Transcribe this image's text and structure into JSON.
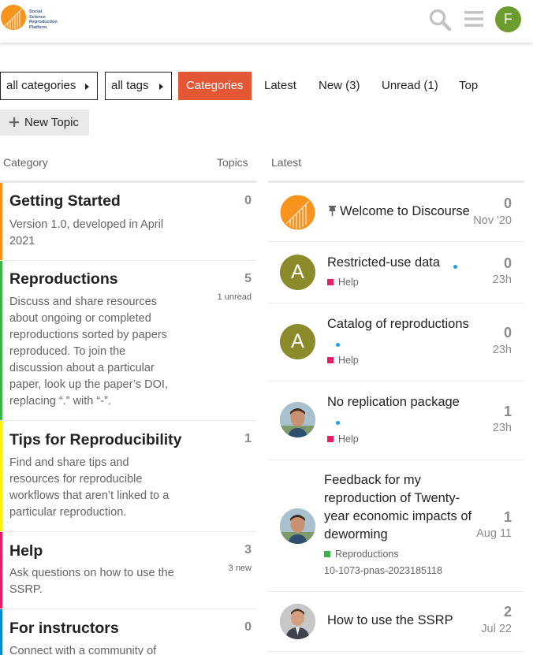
{
  "header": {
    "logo_lines": [
      "Social",
      "Science",
      "Reproduction",
      "Platform"
    ],
    "search_icon": "search-icon",
    "menu_icon": "hamburger-menu-icon",
    "avatar_letter": "F",
    "avatar_color": "#6b9c2d"
  },
  "nav": {
    "categories_dropdown": "all categories",
    "tags_dropdown": "all tags",
    "tabs": [
      "Categories",
      "Latest",
      "New (3)",
      "Unread (1)",
      "Top"
    ],
    "active_tab": "Categories",
    "accent": "#e45735"
  },
  "new_topic_label": "New Topic",
  "columns": {
    "category": "Category",
    "topics": "Topics",
    "latest": "Latest"
  },
  "categories": [
    {
      "name": "Getting Started",
      "description": "Version 1.0, developed in April 2021",
      "count": "0",
      "sub": "",
      "color": "#f7941d"
    },
    {
      "name": "Reproductions",
      "description": "Discuss and share resources about ongoing or completed reproductions sorted by papers reproduced. To join the discussion about a particular paper, look up the paper’s DOI, replacing “.” with “-”.",
      "count": "5",
      "sub": "1 unread",
      "color": "#3ab54a"
    },
    {
      "name": "Tips for Reproducibility",
      "description": "Find and share tips and resources for reproducible workflows that aren’t linked to a particular reproduction.",
      "count": "1",
      "sub": "",
      "color": "#fff200"
    },
    {
      "name": "Help",
      "description": "Ask questions on how to use the SSRP.",
      "count": "3",
      "sub": "3 new",
      "color": "#e71d6a"
    },
    {
      "name": "For instructors",
      "description": "Connect with a community of",
      "count": "0",
      "sub": "",
      "color": "#0088cc"
    }
  ],
  "latest_topics": [
    {
      "title": "Welcome to Discourse",
      "category": "",
      "category_color": "",
      "replies": "0",
      "age": "Nov '20",
      "pinned": true,
      "avatar": "logo",
      "avatar_letter": "",
      "tags": ""
    },
    {
      "title": "Restricted-use data",
      "category": "Help",
      "category_color": "#e71d6a",
      "replies": "0",
      "age": "23h",
      "pinned": false,
      "avatar": "letter",
      "avatar_letter": "A",
      "tags": ""
    },
    {
      "title": "Catalog of reproductions",
      "category": "Help",
      "category_color": "#e71d6a",
      "replies": "0",
      "age": "23h",
      "pinned": false,
      "avatar": "letter",
      "avatar_letter": "A",
      "tags": ""
    },
    {
      "title": "No replication package",
      "category": "Help",
      "category_color": "#e71d6a",
      "replies": "1",
      "age": "23h",
      "pinned": false,
      "avatar": "photo",
      "avatar_letter": "",
      "tags": ""
    },
    {
      "title": "Feedback for my reproduction of Twenty-year economic impacts of deworming",
      "category": "Reproductions",
      "category_color": "#3ab54a",
      "replies": "1",
      "age": "Aug 11",
      "pinned": false,
      "avatar": "photo",
      "avatar_letter": "",
      "tags": "10-1073-pnas-2023185118"
    },
    {
      "title": "How to use the SSRP",
      "category": "",
      "category_color": "",
      "replies": "2",
      "age": "Jul 22",
      "pinned": false,
      "avatar": "photo-suit",
      "avatar_letter": "",
      "tags": ""
    }
  ]
}
